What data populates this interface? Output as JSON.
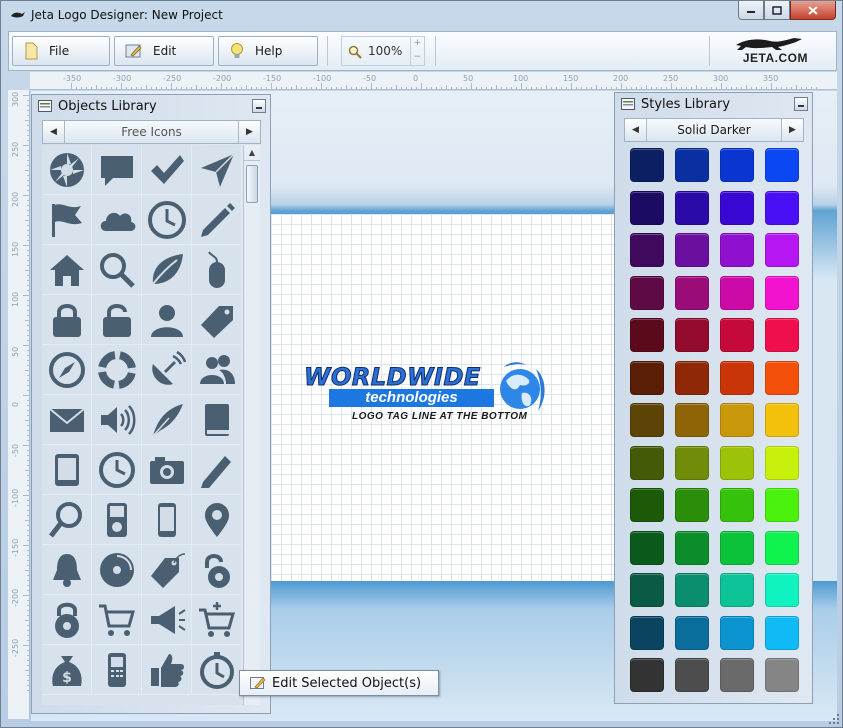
{
  "window": {
    "title": "Jeta Logo Designer: New Project",
    "controls": [
      "minimize",
      "maximize",
      "close"
    ]
  },
  "toolbar": {
    "file_label": "File",
    "edit_label": "Edit",
    "help_label": "Help",
    "zoom_value": "100%",
    "zoom_up": "+",
    "zoom_down": "−",
    "brand": "JETA.COM"
  },
  "rulers": {
    "horizontal": [
      "-350",
      "-300",
      "-250",
      "-200",
      "-150",
      "-100",
      "-50",
      "0",
      "50",
      "100",
      "150",
      "200",
      "250",
      "300",
      "350"
    ],
    "vertical": [
      "300",
      "250",
      "200",
      "150",
      "100",
      "50",
      "0",
      "-50",
      "-100",
      "-150",
      "-200",
      "-250"
    ]
  },
  "objects_library": {
    "title": "Objects Library",
    "category": "Free Icons",
    "icons": [
      "aperture-icon",
      "speech-bubble-icon",
      "checkmark-icon",
      "send-arrow-icon",
      "flag-icon",
      "cloud-icon",
      "clock-icon",
      "pencil-icon",
      "home-icon",
      "magnifier-icon",
      "leaf-icon",
      "mouse-icon",
      "lock-closed-icon",
      "lock-open-icon",
      "user-icon",
      "tag-icon",
      "compass-icon",
      "lifebuoy-icon",
      "satellite-dish-icon",
      "users-icon",
      "envelope-icon",
      "speaker-icon",
      "quill-pen-icon",
      "book-icon",
      "tablet-icon",
      "watch-icon",
      "camera-icon",
      "pencil-alt-icon",
      "search-icon",
      "ipod-icon",
      "phone-icon",
      "map-pin-icon",
      "bell-icon",
      "disc-icon",
      "price-tag-icon",
      "padlock-gear-icon",
      "combination-lock-icon",
      "shopping-cart-icon",
      "megaphone-icon",
      "cart-add-icon",
      "money-bag-icon",
      "mobile-phone-icon",
      "thumbs-up-icon",
      "stopwatch-icon"
    ]
  },
  "styles_library": {
    "title": "Styles Library",
    "category": "Solid Darker",
    "swatches": [
      [
        "#0c1f63",
        "#0a2fa0",
        "#0935d0",
        "#0b47f2"
      ],
      [
        "#1c0a63",
        "#2a0ba8",
        "#3a08d4",
        "#4a10f5"
      ],
      [
        "#3f0a5e",
        "#6a0fa0",
        "#9010d0",
        "#b516f2"
      ],
      [
        "#5e0a45",
        "#9a0c78",
        "#cc0aa8",
        "#f312d0"
      ],
      [
        "#5b0a1c",
        "#930a2c",
        "#c6093b",
        "#f00f4d"
      ],
      [
        "#5a1d06",
        "#8e2806",
        "#c73508",
        "#f14f0a"
      ],
      [
        "#5c4306",
        "#8e6407",
        "#c9980a",
        "#f3c00c"
      ],
      [
        "#445a06",
        "#708c09",
        "#9cc20a",
        "#c7f00d"
      ],
      [
        "#1c5a09",
        "#2a8e0a",
        "#36c20b",
        "#4af20d"
      ],
      [
        "#0a5a1c",
        "#0b8e2a",
        "#0cc23a",
        "#10f24d"
      ],
      [
        "#0a5a45",
        "#0b8e6e",
        "#0cc296",
        "#10f2bf"
      ],
      [
        "#0a4460",
        "#0b6d9c",
        "#0b94d0",
        "#10bbf5"
      ],
      [
        "#333333",
        "#4d4d4d",
        "#6a6a6a",
        "#858585"
      ]
    ]
  },
  "logo": {
    "brand": "WORLDWIDE",
    "subtitle": "technologies",
    "tagline": "LOGO TAG LINE AT THE BOTTOM"
  },
  "context_action": {
    "label": "Edit Selected Object(s)"
  },
  "colors": {
    "accent": "#5aa0d2",
    "icon_fill": "#4a6072"
  }
}
